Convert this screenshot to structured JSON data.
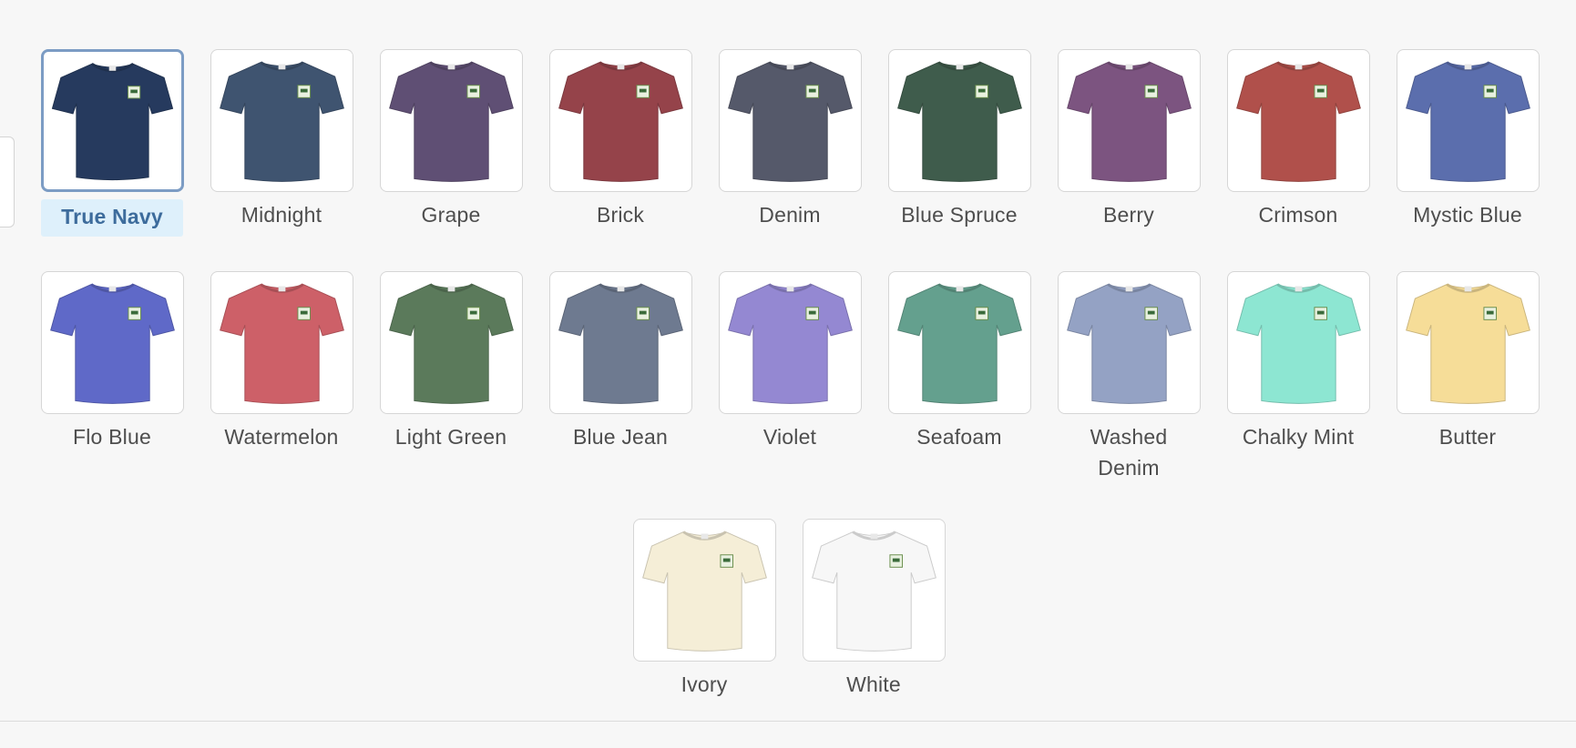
{
  "swatches": [
    {
      "label": "True Navy",
      "color": "#263a5e",
      "selected": true
    },
    {
      "label": "Midnight",
      "color": "#3f5470"
    },
    {
      "label": "Grape",
      "color": "#5f4f74"
    },
    {
      "label": "Brick",
      "color": "#95434a"
    },
    {
      "label": "Denim",
      "color": "#55596a"
    },
    {
      "label": "Blue Spruce",
      "color": "#3f5c4c"
    },
    {
      "label": "Berry",
      "color": "#7c5480"
    },
    {
      "label": "Crimson",
      "color": "#b0504b"
    },
    {
      "label": "Mystic Blue",
      "color": "#5b6ead"
    },
    {
      "label": "Flo Blue",
      "color": "#5f69c8"
    },
    {
      "label": "Watermelon",
      "color": "#cd6068"
    },
    {
      "label": "Light Green",
      "color": "#5b7a5b"
    },
    {
      "label": "Blue Jean",
      "color": "#6e7a90"
    },
    {
      "label": "Violet",
      "color": "#9488d2"
    },
    {
      "label": "Seafoam",
      "color": "#64a08e"
    },
    {
      "label": "Washed Denim",
      "color": "#94a2c4"
    },
    {
      "label": "Chalky Mint",
      "color": "#8de6d2"
    },
    {
      "label": "Butter",
      "color": "#f6dd98"
    },
    {
      "label": "Ivory",
      "color": "#f5eed7"
    },
    {
      "label": "White",
      "color": "#f7f7f7"
    }
  ]
}
